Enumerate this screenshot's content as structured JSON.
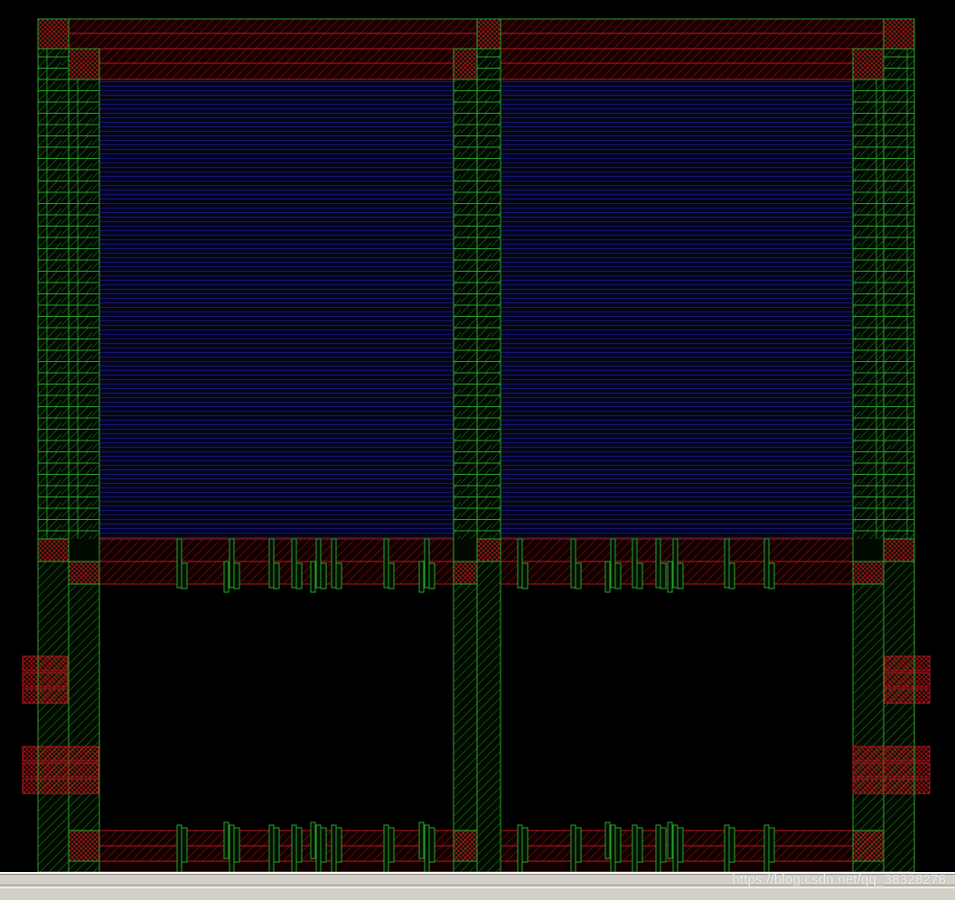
{
  "window": {
    "watermark": "https://blog.csdn.net/qq_38328278"
  },
  "colors": {
    "background": "#000000",
    "metal1_red": "#c0141e",
    "poly_green": "#1fa01f",
    "nwell_blue": "#1c1c8c",
    "status_bar": "#d4d0c8"
  },
  "icons": {
    "layout_canvas": "ic-layout-view"
  }
}
